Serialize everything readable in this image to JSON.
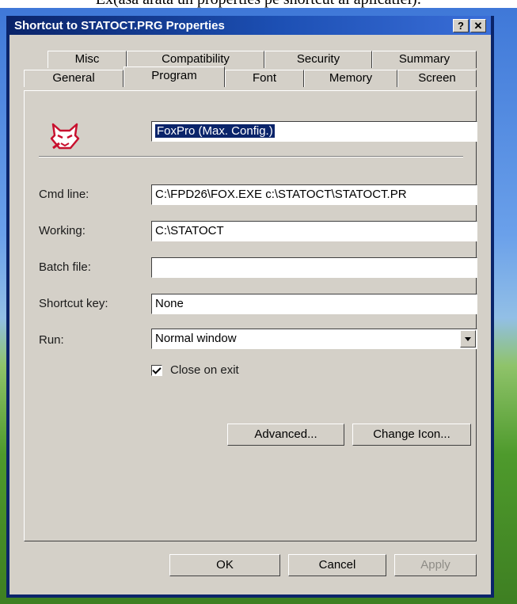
{
  "caption": "Ex(asa arata un properties pe shortcut  al aplicatiei):",
  "window": {
    "title": "Shortcut to STATOCT.PRG Properties",
    "help_label": "?",
    "close_label": "✕"
  },
  "tabs": {
    "row1": [
      "Misc",
      "Compatibility",
      "Security",
      "Summary"
    ],
    "row2": [
      "General",
      "Program",
      "Font",
      "Memory",
      "Screen"
    ],
    "active": "Program"
  },
  "program": {
    "name_value": "FoxPro  (Max. Config.)",
    "cmd_line_label": "Cmd line:",
    "cmd_line_value": "C:\\FPD26\\FOX.EXE c:\\STATOCT\\STATOCT.PR",
    "working_label": "Working:",
    "working_value": "C:\\STATOCT",
    "batch_label": "Batch file:",
    "batch_value": "",
    "shortcut_label": "Shortcut key:",
    "shortcut_value": "None",
    "run_label": "Run:",
    "run_value": "Normal window",
    "close_on_exit_label": "Close on exit",
    "close_on_exit_checked": true,
    "advanced_label": "Advanced...",
    "change_icon_label": "Change Icon..."
  },
  "buttons": {
    "ok": "OK",
    "cancel": "Cancel",
    "apply": "Apply"
  },
  "colors": {
    "titlebar": "#0a246a",
    "dialog_face": "#d4d0c8",
    "selection": "#0a246a",
    "fox_icon": "#c8102e"
  }
}
